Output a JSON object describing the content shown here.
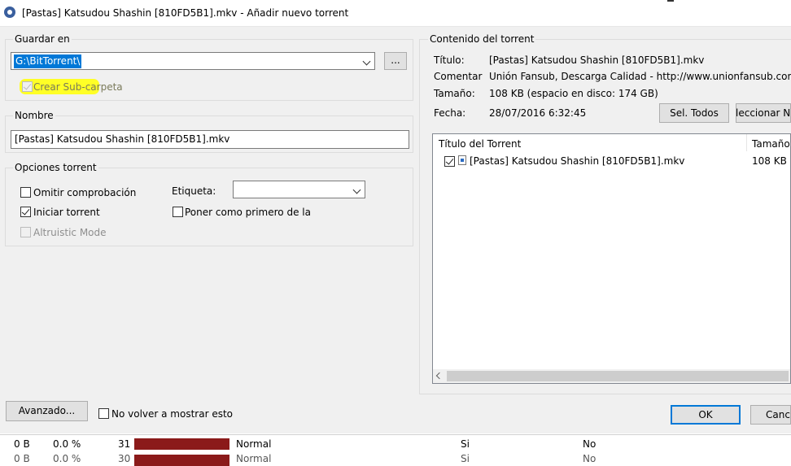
{
  "window": {
    "title": "[Pastas] Katsudou Shashin [810FD5B1].mkv - Añadir nuevo torrent",
    "app_icon": "bittorrent-icon"
  },
  "save_in": {
    "legend": "Guardar en",
    "path": "G:\\BitTorrent\\",
    "browse_label": "...",
    "create_subfolder_label": "Crear Sub-carpeta",
    "create_subfolder_checked": true,
    "create_subfolder_enabled": false,
    "highlight_color": "#ffff26"
  },
  "name": {
    "legend": "Nombre",
    "value": "[Pastas] Katsudou Shashin [810FD5B1].mkv"
  },
  "options": {
    "legend": "Opciones torrent",
    "skip_check_label": "Omitir comprobación",
    "start_torrent_label": "Iniciar torrent",
    "altruistic_label": "Altruistic Mode",
    "label_caption": "Etiqueta:",
    "label_value": "",
    "queue_first_label": "Poner como primero de la cola"
  },
  "content": {
    "legend": "Contenido del torrent",
    "title_key": "Título:",
    "title_value": "[Pastas] Katsudou Shashin [810FD5B1].mkv",
    "comment_key": "Comentari",
    "comment_value": "Unión Fansub, Descarga Calidad - http://www.unionfansub.com",
    "size_key": "Tamaño:",
    "size_value": "108 KB (espacio en disco: 174 GB)",
    "date_key": "Fecha:",
    "date_value": "28/07/2016 6:32:45",
    "select_all_label": "Sel. Todos",
    "select_none_label": "Seleccionar Ninguno",
    "list": {
      "columns": [
        "Título del Torrent",
        "Tamaño"
      ],
      "rows": [
        {
          "name": "[Pastas] Katsudou Shashin [810FD5B1].mkv",
          "size": "108 KB",
          "checked": true
        }
      ]
    }
  },
  "footer": {
    "advanced_label": "Avanzado...",
    "dont_show_label": "No volver a mostrar esto",
    "ok_label": "OK",
    "cancel_label": "Cancelar"
  },
  "background_table": {
    "row1": {
      "size": "0 B",
      "percent": "0.0 %",
      "num": "31",
      "priority": "Normal",
      "col_a": "Si",
      "col_b": "No"
    },
    "row2": {
      "size": "0 B",
      "percent": "0.0 %",
      "num": "30",
      "priority": "Normal",
      "col_a": "Si",
      "col_b": "No"
    },
    "bar_color": "#8b1a1a"
  }
}
